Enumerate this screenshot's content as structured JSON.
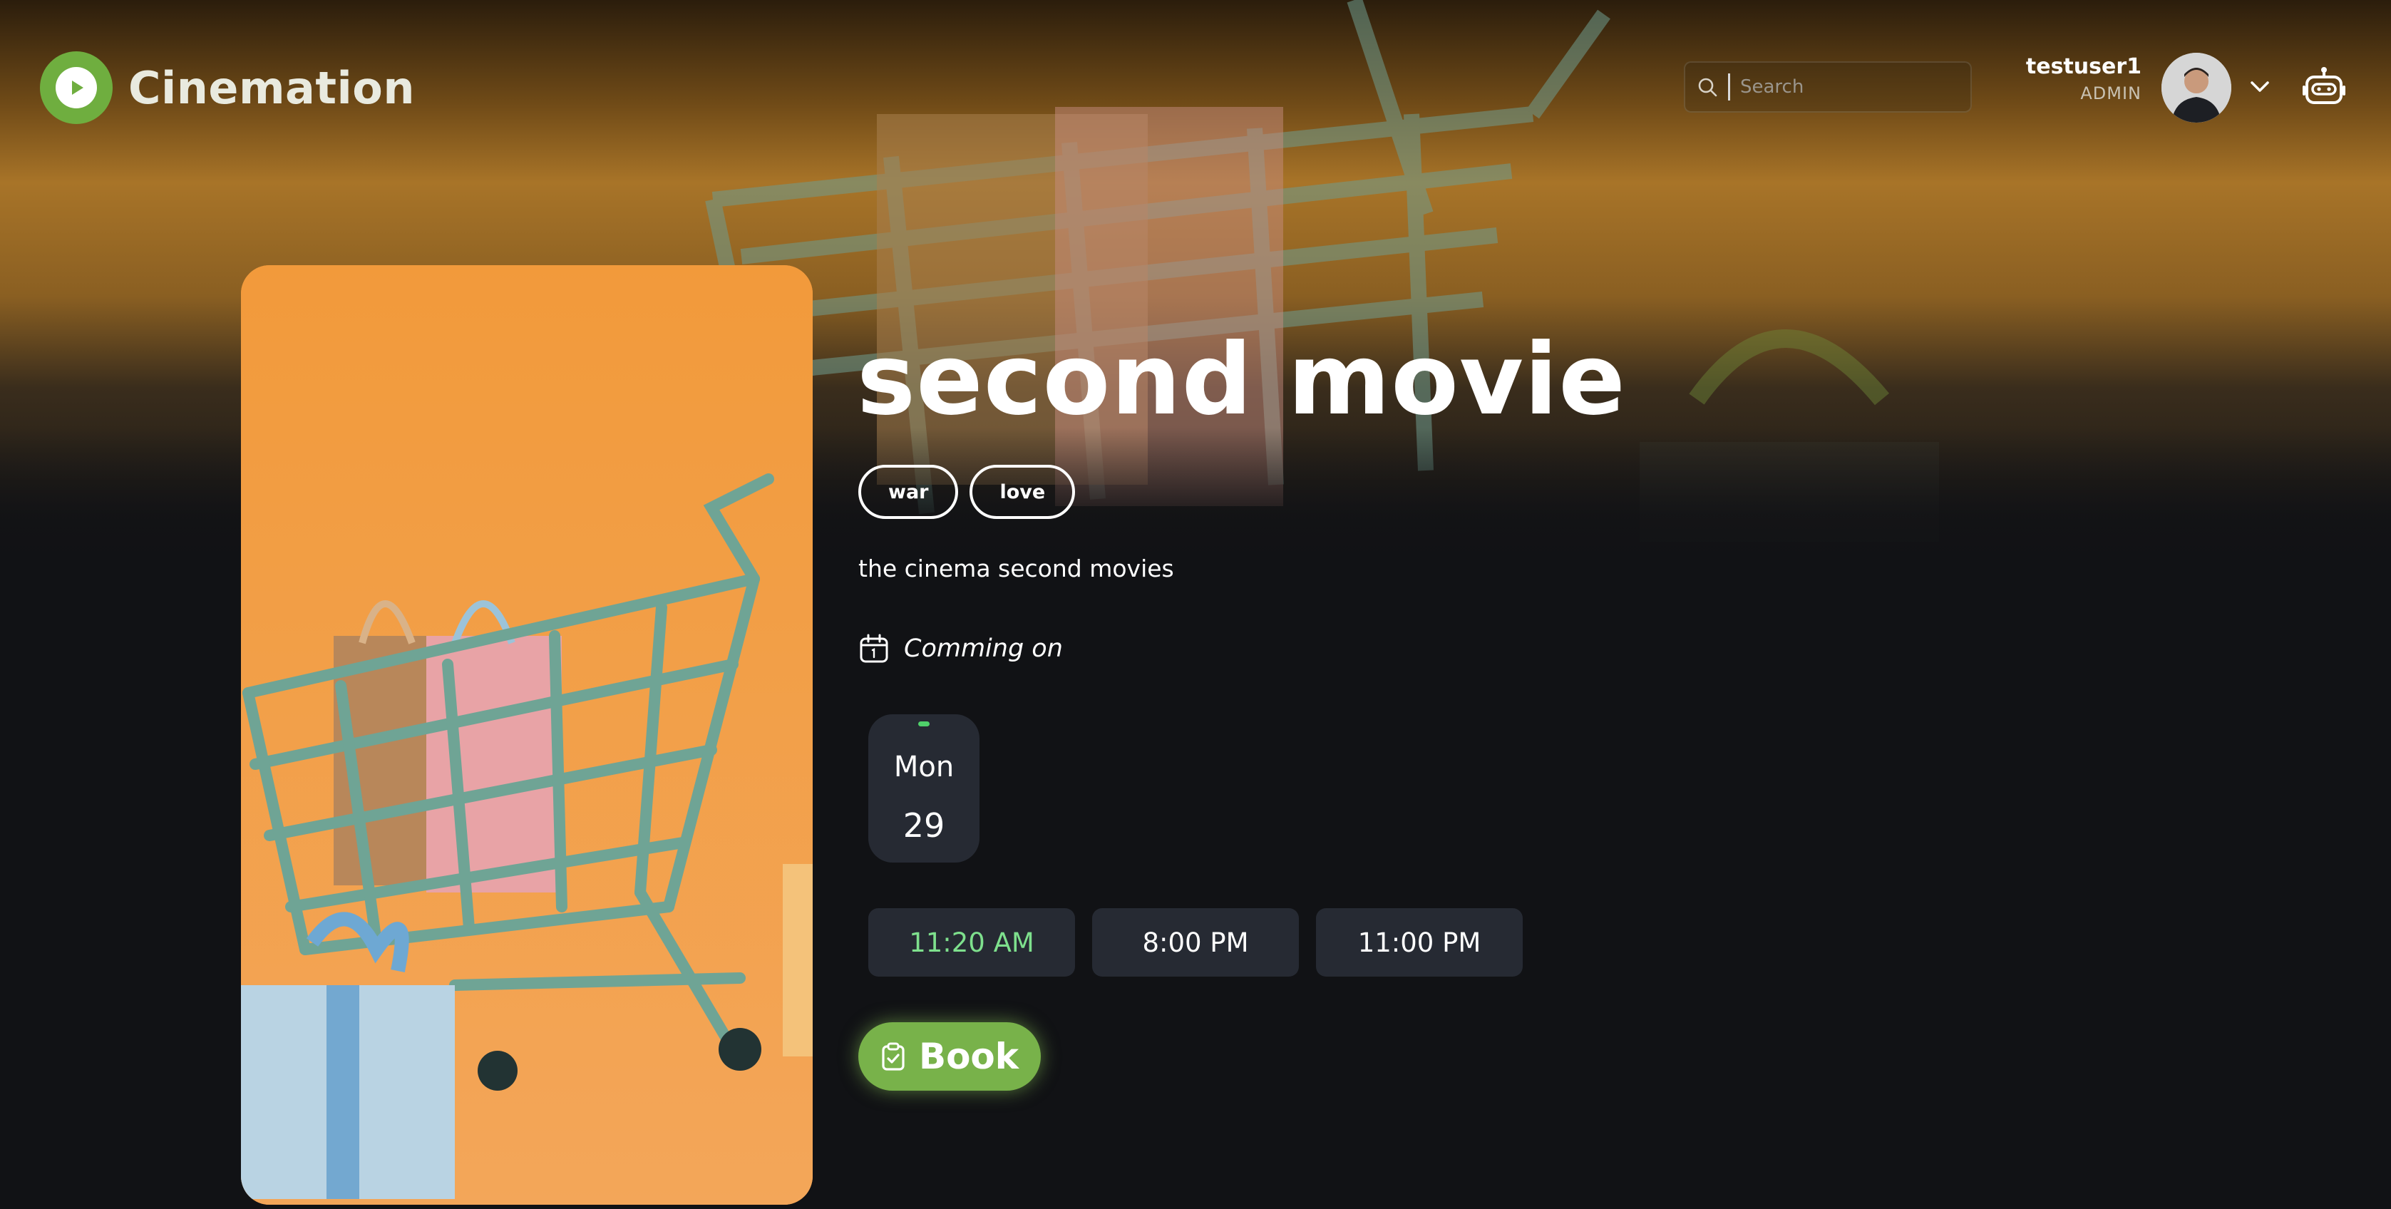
{
  "app": {
    "name": "Cinemation"
  },
  "header": {
    "search_placeholder": "Search",
    "user": {
      "name": "testuser1",
      "role": "ADMIN"
    }
  },
  "movie": {
    "title": "second movie",
    "genres": [
      "war",
      "love"
    ],
    "description": "the cinema second movies",
    "coming_label": "Comming on"
  },
  "schedule": {
    "dates": [
      {
        "day": "Mon",
        "date": "29",
        "selected": true
      }
    ],
    "times": [
      {
        "label": "11:20 AM",
        "selected": true
      },
      {
        "label": "8:00 PM",
        "selected": false
      },
      {
        "label": "11:00 PM",
        "selected": false
      }
    ]
  },
  "actions": {
    "book_label": "Book"
  },
  "icons": {
    "logo": "play-icon",
    "search": "search-icon",
    "dropdown": "chevron-down-icon",
    "assistant": "robot-icon",
    "calendar": "calendar-icon",
    "book": "clipboard-check-icon"
  },
  "colors": {
    "brand_green": "#78b24a",
    "selected_time": "#7ee08d",
    "card_bg": "#262a33",
    "page_bg": "#111215"
  }
}
